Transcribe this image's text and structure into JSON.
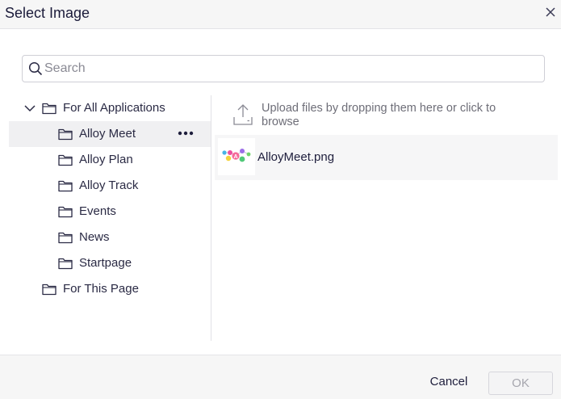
{
  "dialog": {
    "title": "Select Image",
    "close_icon": "close-icon"
  },
  "search": {
    "placeholder": "Search",
    "value": "",
    "icon": "search-icon"
  },
  "tree": {
    "root_all": {
      "label": "For All Applications",
      "expanded": true,
      "icon": "folder-icon"
    },
    "children": [
      {
        "label": "Alloy Meet",
        "selected": true,
        "icon": "folder-icon",
        "menu_icon": "more-icon"
      },
      {
        "label": "Alloy Plan",
        "icon": "folder-icon"
      },
      {
        "label": "Alloy Track",
        "icon": "folder-icon"
      },
      {
        "label": "Events",
        "icon": "folder-icon"
      },
      {
        "label": "News",
        "icon": "folder-icon"
      },
      {
        "label": "Startpage",
        "icon": "folder-icon"
      }
    ],
    "root_page": {
      "label": "For This Page",
      "icon": "folder-icon"
    }
  },
  "upload": {
    "text": "Upload files by dropping them here or click to browse",
    "icon": "upload-icon"
  },
  "files": [
    {
      "name": "AlloyMeet.png",
      "thumbnail": "alloy-meet-logo"
    }
  ],
  "footer": {
    "cancel_label": "Cancel",
    "ok_label": "OK",
    "ok_disabled": true
  },
  "colors": {
    "header_bg": "#f6f6f6",
    "selected_bg": "#f0f0f2",
    "text": "#1e1e3c",
    "muted_text": "#6e6e78",
    "disabled_text": "#a6a6ae"
  }
}
